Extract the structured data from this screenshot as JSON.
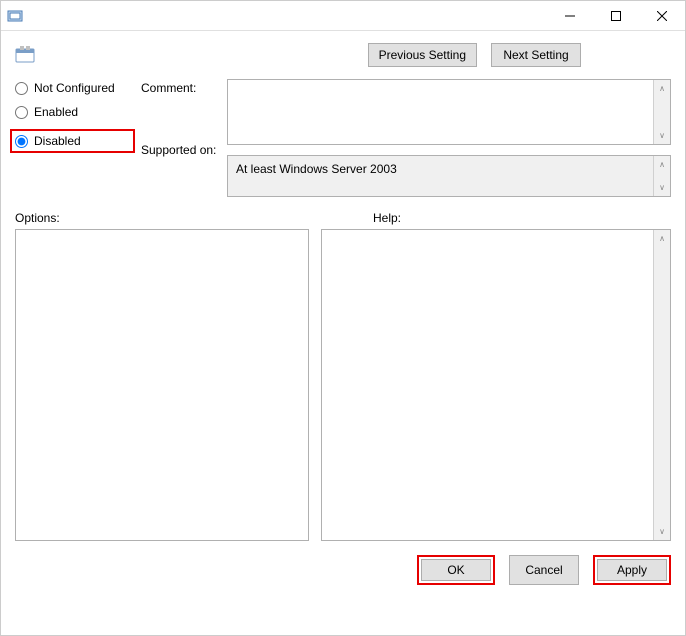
{
  "titlebar": {
    "title": ""
  },
  "nav": {
    "previous_label": "Previous Setting",
    "next_label": "Next Setting"
  },
  "radios": {
    "not_configured": "Not Configured",
    "enabled": "Enabled",
    "disabled": "Disabled",
    "selected": "disabled"
  },
  "labels": {
    "comment": "Comment:",
    "supported_on": "Supported on:",
    "options": "Options:",
    "help": "Help:"
  },
  "fields": {
    "comment_value": "",
    "supported_on_value": "At least Windows Server 2003",
    "options_value": "",
    "help_value": ""
  },
  "buttons": {
    "ok": "OK",
    "cancel": "Cancel",
    "apply": "Apply"
  }
}
